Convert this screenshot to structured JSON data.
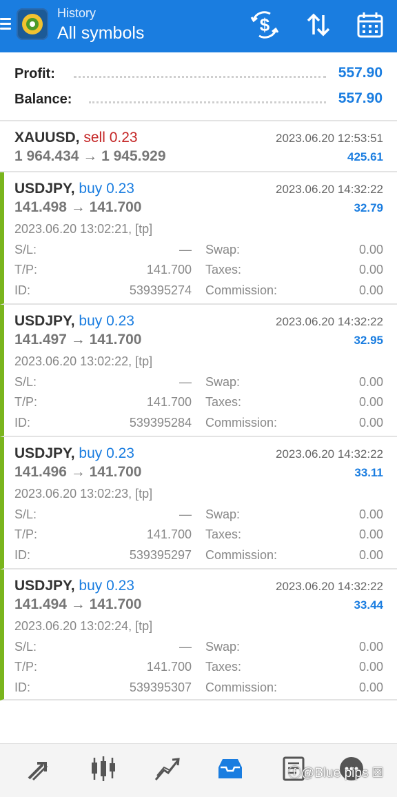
{
  "header": {
    "subtitle": "History",
    "title": "All symbols",
    "icons": [
      "menu-icon",
      "app-logo",
      "currency-exchange-icon",
      "sort-icon",
      "calendar-icon"
    ]
  },
  "summary": {
    "profit_label": "Profit:",
    "profit_value": "557.90",
    "balance_label": "Balance:",
    "balance_value": "557.90"
  },
  "deals": [
    {
      "symbol": "XAUUSD,",
      "side": "sell 0.23",
      "close_time": "2023.06.20 12:53:51",
      "prices": "1 964.434 → 1 945.929",
      "profit": "425.61"
    },
    {
      "symbol": "USDJPY,",
      "side": "buy 0.23",
      "close_time": "2023.06.20 14:32:22",
      "prices": "141.498 → 141.700",
      "profit": "32.79",
      "open_time": "2023.06.20 13:02:21, [tp]",
      "sl_label": "S/L:",
      "sl": "—",
      "tp_label": "T/P:",
      "tp": "141.700",
      "id_label": "ID:",
      "id": "539395274",
      "swap_label": "Swap:",
      "swap": "0.00",
      "taxes_label": "Taxes:",
      "taxes": "0.00",
      "commission_label": "Commission:",
      "commission": "0.00"
    },
    {
      "symbol": "USDJPY,",
      "side": "buy 0.23",
      "close_time": "2023.06.20 14:32:22",
      "prices": "141.497 → 141.700",
      "profit": "32.95",
      "open_time": "2023.06.20 13:02:22, [tp]",
      "sl_label": "S/L:",
      "sl": "—",
      "tp_label": "T/P:",
      "tp": "141.700",
      "id_label": "ID:",
      "id": "539395284",
      "swap_label": "Swap:",
      "swap": "0.00",
      "taxes_label": "Taxes:",
      "taxes": "0.00",
      "commission_label": "Commission:",
      "commission": "0.00"
    },
    {
      "symbol": "USDJPY,",
      "side": "buy 0.23",
      "close_time": "2023.06.20 14:32:22",
      "prices": "141.496 → 141.700",
      "profit": "33.11",
      "open_time": "2023.06.20 13:02:23, [tp]",
      "sl_label": "S/L:",
      "sl": "—",
      "tp_label": "T/P:",
      "tp": "141.700",
      "id_label": "ID:",
      "id": "539395297",
      "swap_label": "Swap:",
      "swap": "0.00",
      "taxes_label": "Taxes:",
      "taxes": "0.00",
      "commission_label": "Commission:",
      "commission": "0.00"
    },
    {
      "symbol": "USDJPY,",
      "side": "buy 0.23",
      "close_time": "2023.06.20 14:32:22",
      "prices": "141.494 → 141.700",
      "profit": "33.44",
      "open_time": "2023.06.20 13:02:24, [tp]",
      "sl_label": "S/L:",
      "sl": "—",
      "tp_label": "T/P:",
      "tp": "141.700",
      "id_label": "ID:",
      "id": "539395307",
      "swap_label": "Swap:",
      "swap": "0.00",
      "taxes_label": "Taxes:",
      "taxes": "0.00",
      "commission_label": "Commission:",
      "commission": "0.00"
    }
  ],
  "bottom_nav": {
    "items": [
      "quotes-icon",
      "chart-icon",
      "trade-icon",
      "history-icon",
      "news-icon",
      "chat-icon"
    ],
    "active": "history-icon"
  },
  "watermark": "ⓕ@Blue pips ☒",
  "colors": {
    "accent": "#1a7de0",
    "sell": "#c42525",
    "buy_marker": "#7ab51d"
  }
}
